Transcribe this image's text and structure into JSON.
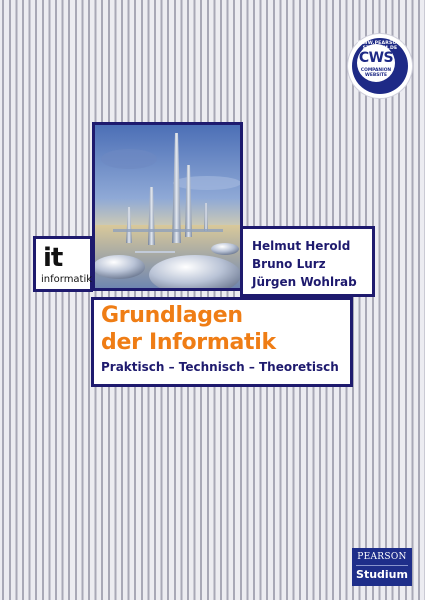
{
  "badge": {
    "ring_text": "WWW.PEARSON-STUDIUM.DE",
    "logo": "CWS",
    "line1": "COMPANION",
    "line2": "WEBSITE"
  },
  "series": {
    "code": "it",
    "label": "informatik"
  },
  "authors": [
    "Helmut Herold",
    "Bruno Lurz",
    "Jürgen Wohlrab"
  ],
  "title": {
    "line1": "Grundlagen",
    "line2": "der Informatik",
    "subtitle": "Praktisch – Technisch – Theoretisch"
  },
  "publisher": {
    "name": "PEARSON",
    "imprint": "Studium"
  },
  "colors": {
    "frame_navy": "#1e1a6e",
    "title_orange": "#ef7d15",
    "publisher_blue": "#1e2e8a"
  }
}
